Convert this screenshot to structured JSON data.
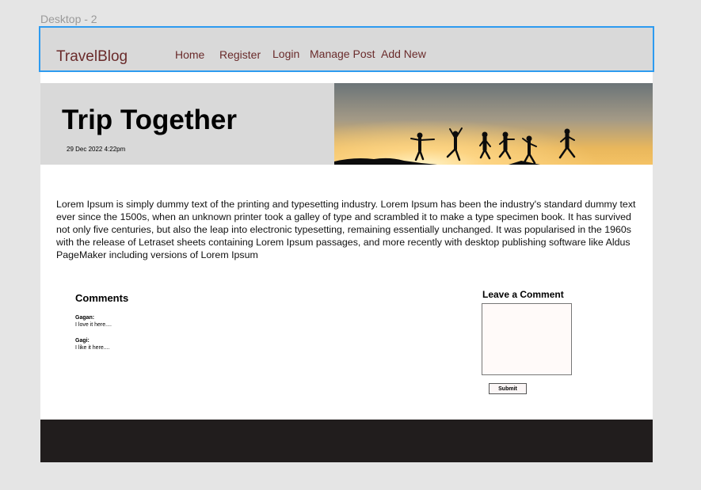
{
  "frame": {
    "label": "Desktop - 2"
  },
  "nav": {
    "brand": "TravelBlog",
    "links": [
      "Home",
      "Register",
      "Login",
      "Manage Post",
      "Add New"
    ]
  },
  "hero": {
    "title": "Trip Together",
    "date": "29 Dec 2022 4:22pm",
    "photo": "sunset-silhouettes-jumping"
  },
  "article": {
    "body": "Lorem Ipsum is simply dummy text of the printing and typesetting industry. Lorem Ipsum has been the industry's standard dummy text ever since the 1500s, when an unknown printer took a galley of type and scrambled it to make a type specimen book. It has survived not only five centuries, but also the leap into electronic typesetting, remaining essentially unchanged. It was popularised in the 1960s with the release of Letraset sheets containing Lorem Ipsum passages, and more recently with desktop publishing software like Aldus PageMaker including versions of Lorem Ipsum"
  },
  "comments": {
    "title": "Comments",
    "items": [
      {
        "author": "Gagan:",
        "text": "I love it here...."
      },
      {
        "author": "Gagi:",
        "text": "I like it here...."
      }
    ]
  },
  "leave_comment": {
    "title": "Leave a Comment",
    "value": "",
    "submit_label": "Submit"
  },
  "colors": {
    "accent_link": "#6a2b2b",
    "nav_bg": "#d9d9d9",
    "selection_outline": "#2d9bf0",
    "footer_bg": "#211d1d"
  }
}
